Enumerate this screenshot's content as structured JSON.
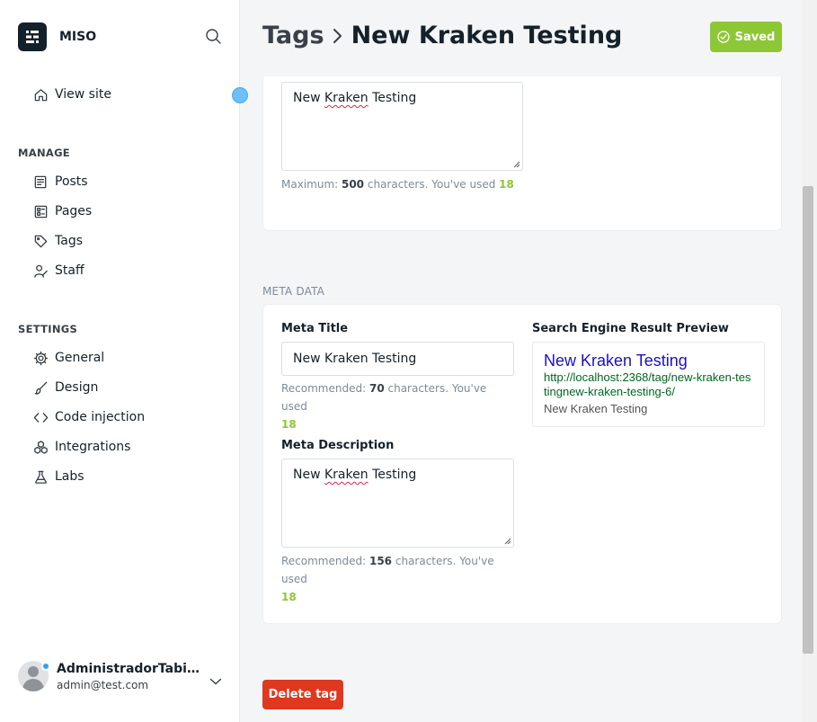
{
  "sidebar": {
    "brand": "MISO",
    "view_site": "View site",
    "manage_label": "MANAGE",
    "manage_items": [
      "Posts",
      "Pages",
      "Tags",
      "Staff"
    ],
    "settings_label": "SETTINGS",
    "settings_items": [
      "General",
      "Design",
      "Code injection",
      "Integrations",
      "Labs"
    ],
    "user": {
      "name": "AdministradorTabith...",
      "email": "admin@test.com"
    }
  },
  "header": {
    "breadcrumb_parent": "Tags",
    "title": "New Kraken Testing",
    "saved_label": "Saved"
  },
  "description": {
    "value": [
      "New ",
      "Kraken",
      " Testing"
    ],
    "hint_prefix": "Maximum: ",
    "max": "500",
    "hint_mid": " characters. You've used ",
    "used": "18"
  },
  "meta": {
    "section_label": "META DATA",
    "title_label": "Meta Title",
    "title_value": "New Kraken Testing",
    "title_hint_prefix": "Recommended: ",
    "title_recommended": "70",
    "title_hint_mid": " characters. You've used",
    "title_used": "18",
    "desc_label": "Meta Description",
    "desc_value": [
      "New ",
      "Kraken",
      " Testing"
    ],
    "desc_hint_prefix": "Recommended: ",
    "desc_recommended": "156",
    "desc_hint_mid": " characters. You've used",
    "desc_used": "18",
    "preview_label": "Search Engine Result Preview",
    "preview_title": "New Kraken Testing",
    "preview_url": "http://localhost:2368/tag/new-kraken-testingnew-kraken-testing-6/",
    "preview_desc": "New Kraken Testing"
  },
  "actions": {
    "delete_label": "Delete tag"
  },
  "colors": {
    "accent_green": "#8ec735",
    "danger": "#e0371f",
    "serp_title": "#1e0fbe",
    "serp_url": "#006621"
  }
}
